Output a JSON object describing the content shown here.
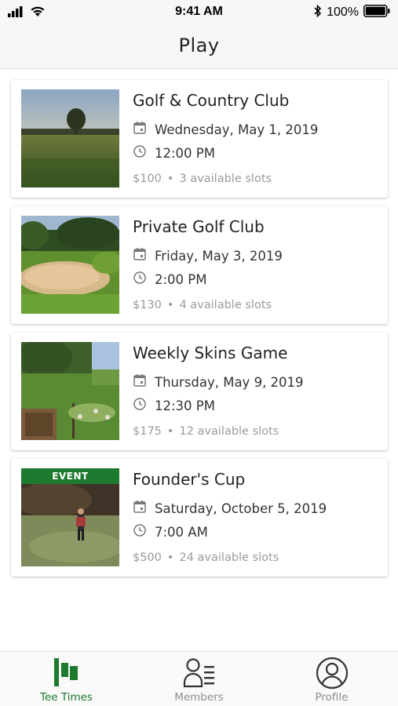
{
  "status_bar": {
    "time": "9:41 AM",
    "battery": "100%",
    "icons": [
      "signal-icon",
      "wifi-icon",
      "bluetooth-icon",
      "battery-icon"
    ]
  },
  "nav": {
    "title": "Play"
  },
  "tee_times": [
    {
      "name": "Golf & Country Club",
      "date": "Wednesday, May 1, 2019",
      "time": "12:00 PM",
      "price": "$100",
      "slots": "3 available slots",
      "badge": ""
    },
    {
      "name": "Private Golf Club",
      "date": "Friday, May 3, 2019",
      "time": "2:00 PM",
      "price": "$130",
      "slots": "4 available slots",
      "badge": ""
    },
    {
      "name": "Weekly Skins Game",
      "date": "Thursday, May 9, 2019",
      "time": "12:30 PM",
      "price": "$175",
      "slots": "12 available slots",
      "badge": ""
    },
    {
      "name": "Founder's Cup",
      "date": "Saturday, October 5, 2019",
      "time": "7:00 AM",
      "price": "$500",
      "slots": "24 available slots",
      "badge": "EVENT"
    }
  ],
  "tabs": [
    {
      "label": "Tee Times",
      "icon": "flag-icon",
      "active": true
    },
    {
      "label": "Members",
      "icon": "members-icon",
      "active": false
    },
    {
      "label": "Profile",
      "icon": "profile-icon",
      "active": false
    }
  ],
  "colors": {
    "accent": "#1e7a2e",
    "inactive": "#8e8e8e",
    "meta_text": "#9a9a9a"
  }
}
